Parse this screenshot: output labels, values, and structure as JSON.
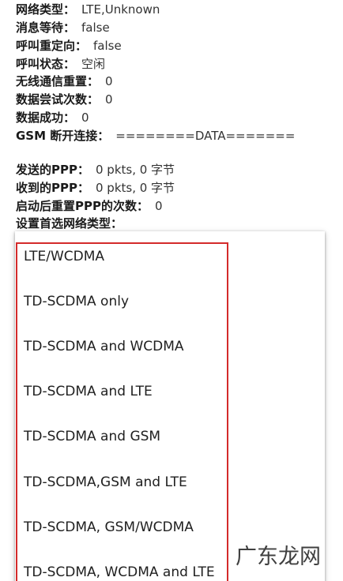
{
  "info": [
    {
      "label": "网络类型：",
      "value": "LTE,Unknown"
    },
    {
      "label": "消息等待：",
      "value": "false"
    },
    {
      "label": "呼叫重定向：",
      "value": "false"
    },
    {
      "label": "呼叫状态：",
      "value": "空闲"
    },
    {
      "label": "无线通信重置：",
      "value": "0"
    },
    {
      "label": "数据尝试次数：",
      "value": "0"
    },
    {
      "label": "数据成功：",
      "value": "0"
    },
    {
      "label": "GSM 断开连接：",
      "value": "========DATA======="
    },
    {
      "label": "发送的PPP：",
      "value": "0 pkts, 0 字节"
    },
    {
      "label": "收到的PPP：",
      "value": "0 pkts, 0 字节"
    },
    {
      "label": "启动后重置PPP的次数：",
      "value": "0"
    },
    {
      "label": "设置首选网络类型：",
      "value": ""
    }
  ],
  "network_options": [
    "LTE/WCDMA",
    "TD-SCDMA only",
    "TD-SCDMA and WCDMA",
    "TD-SCDMA and LTE",
    "TD-SCDMA and GSM",
    "TD-SCDMA,GSM and LTE",
    "TD-SCDMA, GSM/WCDMA",
    "TD-SCDMA, WCDMA and LTE"
  ],
  "watermark": "广东龙网",
  "colors": {
    "highlight_border": "#d42b2b"
  }
}
